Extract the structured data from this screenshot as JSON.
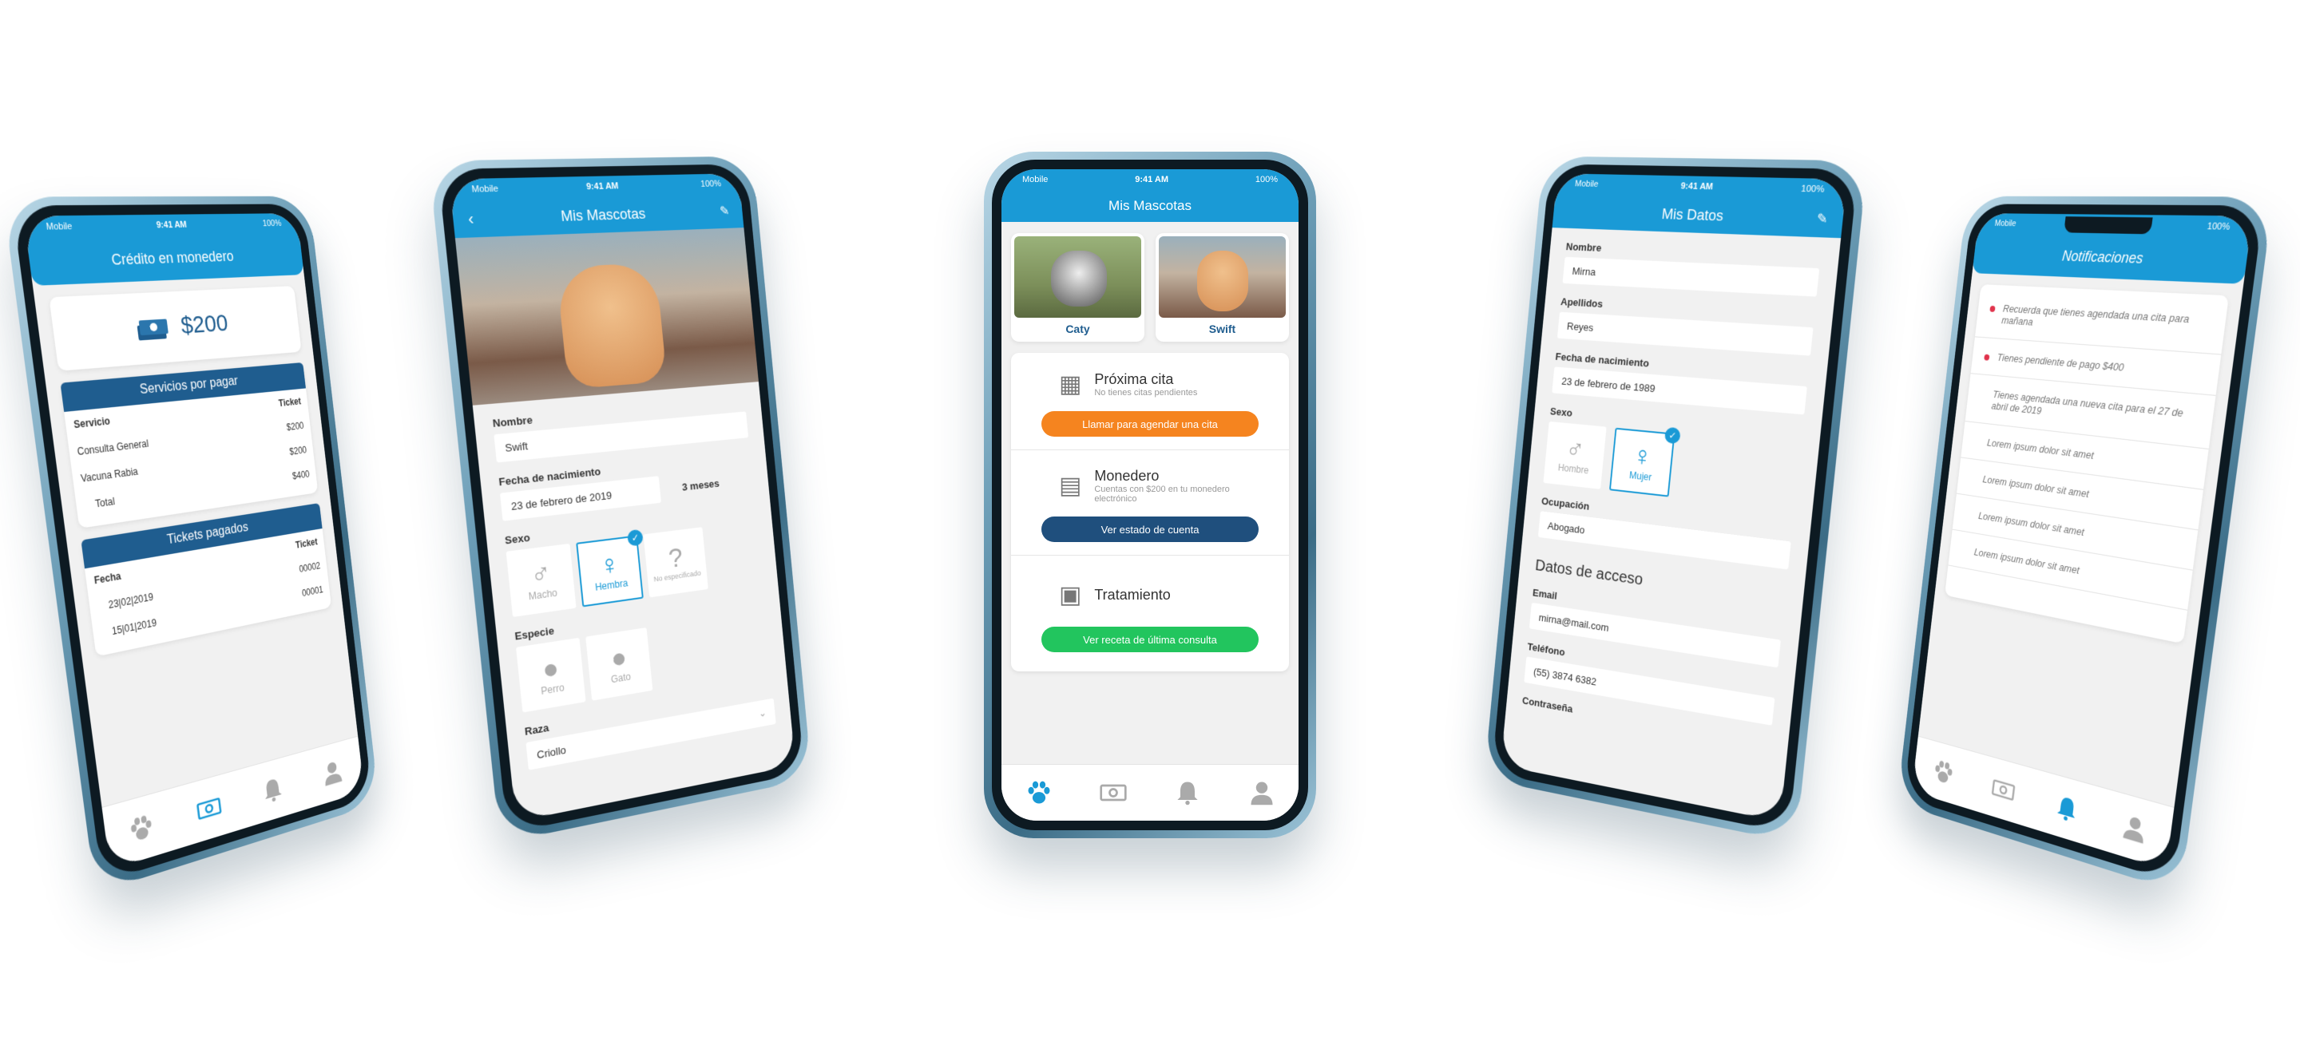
{
  "colors": {
    "primary": "#1a9ad6",
    "dark_blue": "#1f5d8f",
    "orange": "#f5841f",
    "green": "#22c55e",
    "red_dot": "#e0334c"
  },
  "status": {
    "carrier": "Mobile",
    "time": "9:41 AM",
    "battery": "100%"
  },
  "phone1": {
    "title": "Crédito en monedero",
    "balance": "$200",
    "services": {
      "header": "Servicios por pagar",
      "col_service": "Servicio",
      "col_ticket": "Ticket",
      "rows": [
        {
          "name": "Consulta General",
          "amount": "$200"
        },
        {
          "name": "Vacuna Rabia",
          "amount": "$200"
        }
      ],
      "total_label": "Total",
      "total_value": "$400"
    },
    "tickets": {
      "header": "Tickets pagados",
      "col_date": "Fecha",
      "col_ticket": "Ticket",
      "rows": [
        {
          "date": "23|02|2019",
          "ticket": "00002"
        },
        {
          "date": "15|01|2019",
          "ticket": "00001"
        }
      ]
    }
  },
  "phone2": {
    "title": "Mis Mascotas",
    "name_label": "Nombre",
    "name_value": "Swift",
    "dob_label": "Fecha de nacimiento",
    "dob_value": "23 de febrero de 2019",
    "age": "3 meses",
    "sex_label": "Sexo",
    "sex_options": [
      "Macho",
      "Hembra",
      "No especificado"
    ],
    "species_label": "Especie",
    "species_options": [
      "Perro",
      "Gato"
    ],
    "breed_label": "Raza",
    "breed_value": "Criollo"
  },
  "phone3": {
    "title": "Mis Mascotas",
    "pets": [
      {
        "name": "Caty"
      },
      {
        "name": "Swift"
      }
    ],
    "next_title": "Próxima cita",
    "next_sub": "No tienes citas pendientes",
    "next_btn": "Llamar para agendar una cita",
    "wallet_title": "Monedero",
    "wallet_sub": "Cuentas con $200 en tu monedero electrónico",
    "wallet_btn": "Ver estado de cuenta",
    "treat_title": "Tratamiento",
    "treat_btn": "Ver receta de última consulta"
  },
  "phone4": {
    "title": "Mis Datos",
    "nombre_label": "Nombre",
    "nombre_value": "Mirna",
    "apellidos_label": "Apellidos",
    "apellidos_value": "Reyes",
    "dob_label": "Fecha de nacimiento",
    "dob_value": "23 de febrero de 1989",
    "sex_label": "Sexo",
    "sex_options": [
      "Hombre",
      "Mujer"
    ],
    "ocup_label": "Ocupación",
    "ocup_value": "Abogado",
    "access_title": "Datos de acceso",
    "email_label": "Email",
    "email_value": "mirna@mail.com",
    "tel_label": "Teléfono",
    "tel_value": "(55) 3874 6382",
    "pass_label": "Contraseña"
  },
  "phone5": {
    "title": "Notificaciones",
    "items": [
      {
        "text": "Recuerda que tienes agendada una cita para mañana",
        "unread": true
      },
      {
        "text": "Tienes pendiente de pago $400",
        "unread": true
      },
      {
        "text": "Tienes agendada una nueva cita para el 27 de abril de 2019",
        "unread": false
      },
      {
        "text": "Lorem ipsum dolor sit amet",
        "unread": false
      },
      {
        "text": "Lorem ipsum dolor sit amet",
        "unread": false
      },
      {
        "text": "Lorem ipsum dolor sit amet",
        "unread": false
      },
      {
        "text": "Lorem ipsum dolor sit amet",
        "unread": false
      }
    ]
  }
}
